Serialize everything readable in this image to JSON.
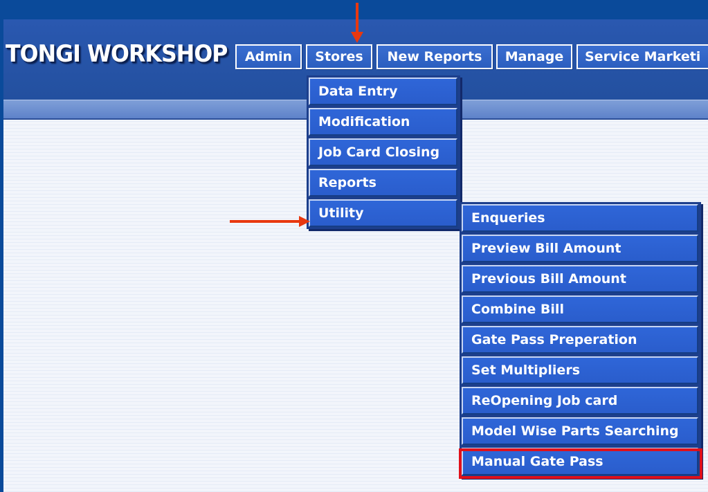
{
  "app": {
    "title": "TONGI WORKSHOP"
  },
  "topnav": [
    {
      "label": "Admin"
    },
    {
      "label": "Stores"
    },
    {
      "label": "New Reports"
    },
    {
      "label": "Manage"
    },
    {
      "label": "Service Marketi"
    }
  ],
  "stores_menu": [
    {
      "label": "Data Entry"
    },
    {
      "label": "Modification"
    },
    {
      "label": "Job Card Closing"
    },
    {
      "label": "Reports"
    },
    {
      "label": "Utility"
    }
  ],
  "utility_menu": [
    {
      "label": "Enqueries"
    },
    {
      "label": "Preview Bill Amount"
    },
    {
      "label": "Previous Bill Amount"
    },
    {
      "label": "Combine Bill"
    },
    {
      "label": "Gate Pass Preperation"
    },
    {
      "label": "Set Multipliers"
    },
    {
      "label": "ReOpening Job card"
    },
    {
      "label": "Model Wise Parts Searching"
    },
    {
      "label": "Manual Gate Pass"
    }
  ],
  "annotations": {
    "arrow_color": "#e8380f",
    "highlight_color": "#e0101a"
  }
}
